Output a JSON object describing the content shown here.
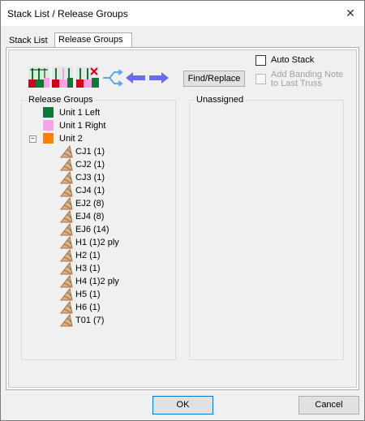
{
  "window": {
    "title": "Stack List / Release Groups"
  },
  "tabs": [
    {
      "label": "Stack List",
      "active": false
    },
    {
      "label": "Release Groups",
      "active": true
    }
  ],
  "toolbar": {
    "find_replace_label": "Find/Replace",
    "auto_stack_label": "Auto Stack",
    "auto_stack_checked": false,
    "banding_note_label_line1": "Add Banding Note",
    "banding_note_label_line2": "to Last Truss",
    "banding_note_checked": false,
    "banding_note_enabled": false,
    "icons": [
      "stack-icon-1",
      "stack-icon-2",
      "stack-icon-3",
      "split-arrows-icon",
      "left-arrow-icon",
      "right-arrow-icon"
    ]
  },
  "release_groups": {
    "title": "Release Groups",
    "groups": [
      {
        "label": "Unit 1 Left",
        "color": "#0a7a36"
      },
      {
        "label": "Unit 1 Right",
        "color": "#f7a3e8"
      },
      {
        "label": "Unit 2",
        "color": "#ff8000",
        "expanded": true
      }
    ],
    "unit2_children": [
      "CJ1 (1)",
      "CJ2 (1)",
      "CJ3 (1)",
      "CJ4 (1)",
      "EJ2 (8)",
      "EJ4 (8)",
      "EJ6 (14)",
      "H1 (1)2 ply",
      "H2 (1)",
      "H3 (1)",
      "H4 (1)2 ply",
      "H5 (1)",
      "H6 (1)",
      "T01 (7)"
    ]
  },
  "unassigned": {
    "title": "Unassigned"
  },
  "buttons": {
    "ok": "OK",
    "cancel": "Cancel"
  },
  "colors": {
    "accent_border": "#0078d7",
    "truss_icon": "#a0704a"
  }
}
